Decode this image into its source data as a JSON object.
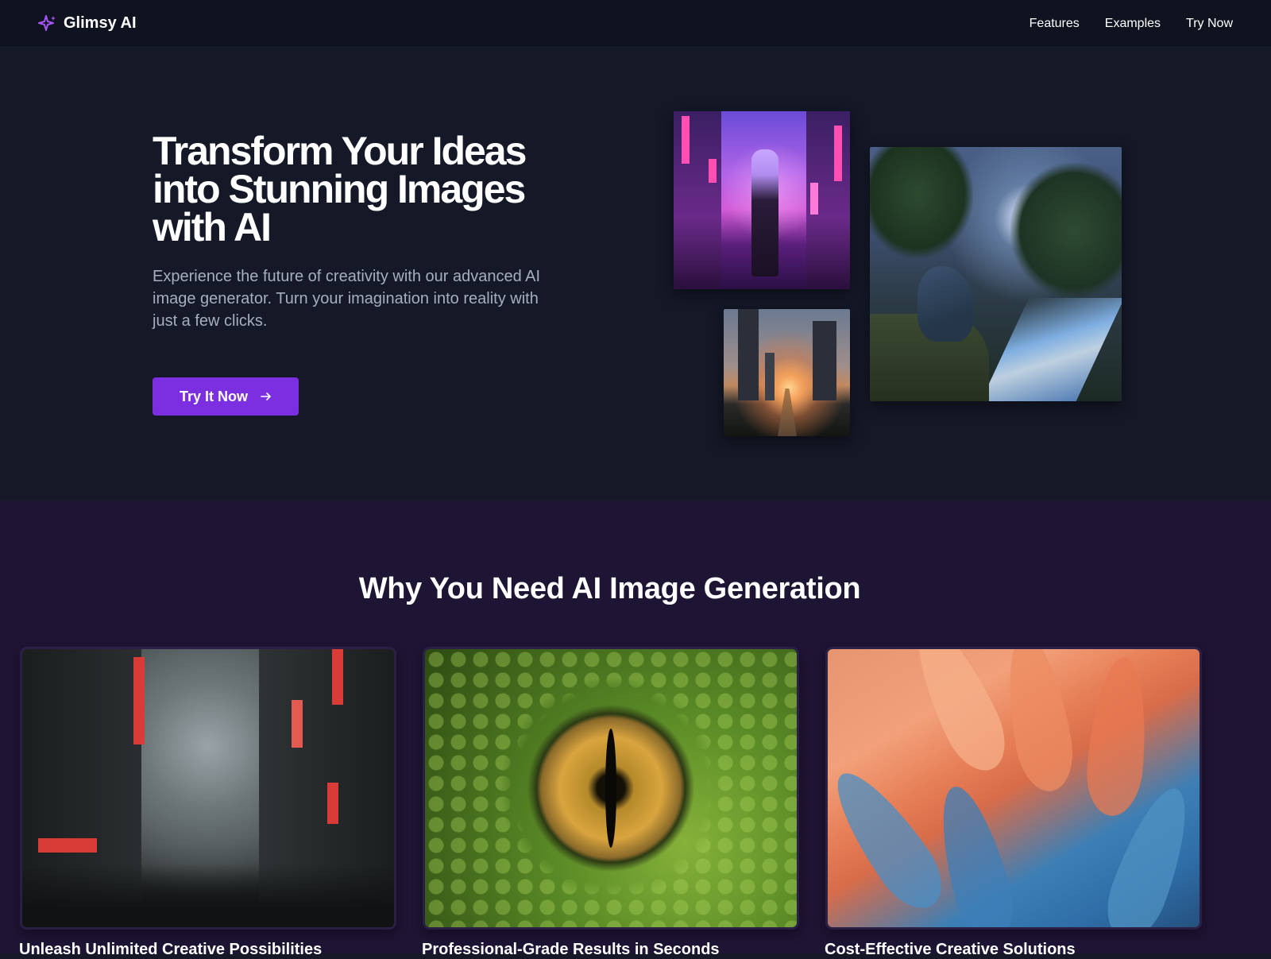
{
  "nav": {
    "brand": "Glimsy AI",
    "brand_icon": "sparkles-icon",
    "links": [
      "Features",
      "Examples",
      "Try Now"
    ]
  },
  "hero": {
    "title": "Transform Your Ideas into Stunning Images with AI",
    "subtitle": "Experience the future of creativity with our advanced AI image generator. Turn your imagination into reality with just a few clicks.",
    "cta_label": "Try It Now",
    "cta_icon": "arrow-right-icon"
  },
  "section": {
    "title": "Why You Need AI Image Generation",
    "cards": [
      {
        "title": "Unleash Unlimited Creative Possibilities"
      },
      {
        "title": "Professional-Grade Results in Seconds"
      },
      {
        "title": "Cost-Effective Creative Solutions"
      }
    ]
  },
  "colors": {
    "background": "#141827",
    "navbar": "#0f1320",
    "section_background": "#1e1433",
    "accent": "#7c2fe0",
    "subtitle_text": "#a7aebf"
  }
}
